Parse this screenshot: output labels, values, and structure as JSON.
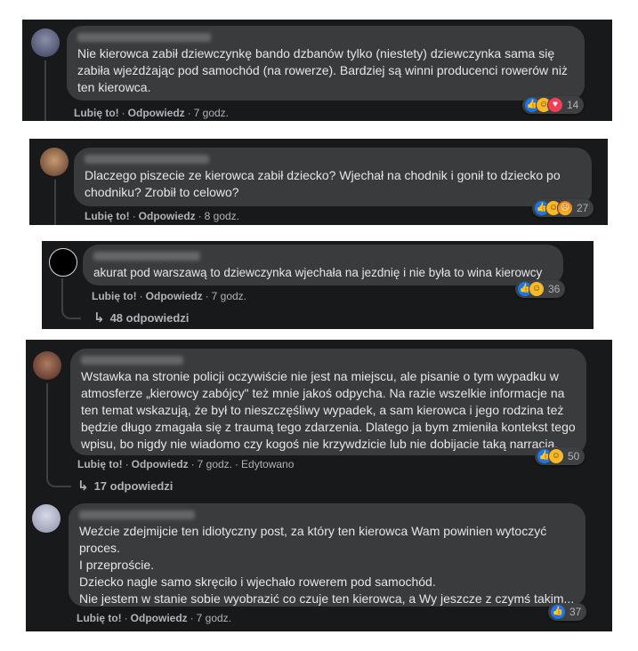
{
  "comments": [
    {
      "text": "Nie kierowca zabił dziewczynkę bando dzbanów tylko (niestety) dziewczynka sama się zabiła wjeżdżając pod samochód (na rowerze). Bardziej są winni producenci rowerów niż ten kierowca.",
      "like": "Lubię to!",
      "reply": "Odpowiedz",
      "time": "7 godz.",
      "reactions": [
        "like-icon",
        "haha-icon",
        "love-icon"
      ],
      "count": "14"
    },
    {
      "text": "Dlaczego piszecie ze kierowca zabił dziecko? Wjechał na chodnik i gonił to dziecko po chodniku? Zrobił to celowo?",
      "like": "Lubię to!",
      "reply": "Odpowiedz",
      "time": "8 godz.",
      "reactions": [
        "like-icon",
        "haha-icon",
        "angry-icon"
      ],
      "count": "27"
    },
    {
      "text": "akurat pod warszawą to dziewczynka wjechała na jezdnię i nie była to wina kierowcy",
      "like": "Lubię to!",
      "reply": "Odpowiedz",
      "time": "7 godz.",
      "reactions": [
        "like-icon",
        "haha-icon"
      ],
      "count": "36",
      "replies": "48 odpowiedzi"
    },
    {
      "text": "Wstawka na stronie policji oczywiście nie jest na miejscu, ale pisanie o tym wypadku w atmosferze „kierowcy zabójcy\" też mnie jakoś odpycha. Na razie wszelkie informacje na ten temat wskazują, że był to nieszczęśliwy wypadek, a sam kierowca i jego rodzina też będzie długo zmagała się z traumą tego zdarzenia. Dlatego ja bym zmieniła kontekst tego wpisu, bo nigdy nie wiadomo czy kogoś nie krzywdzicie lub nie dobijacie taką narracją.",
      "like": "Lubię to!",
      "reply": "Odpowiedz",
      "time": "7 godz.",
      "edited": "Edytowano",
      "reactions": [
        "like-icon",
        "haha-icon"
      ],
      "count": "50",
      "replies": "17 odpowiedzi"
    },
    {
      "lines": [
        "Weźcie zdejmijcie ten idiotyczny post, za który ten kierowca Wam powinien wytoczyć proces.",
        "I przeproście.",
        "Dziecko nagle samo skręciło i wjechało rowerem pod samochód.",
        "Nie jestem w stanie sobie wyobrazić co czuje ten kierowca, a Wy jeszcze z czymś takim..."
      ],
      "like": "Lubię to!",
      "reply": "Odpowiedz",
      "time": "7 godz.",
      "reactions": [
        "like-icon"
      ],
      "count": "37"
    }
  ],
  "colors": {
    "card_bg": "#18191a",
    "bubble_bg": "#3a3b3c",
    "text": "#e4e6eb",
    "meta": "#b0b3b8",
    "like": "#1877f2"
  }
}
